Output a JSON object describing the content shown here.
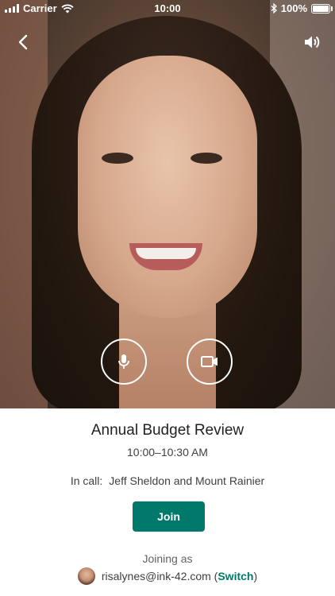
{
  "status_bar": {
    "carrier": "Carrier",
    "time": "10:00",
    "battery": "100%",
    "battery_level": 1.0
  },
  "icons": {
    "back": "chevron-left-icon",
    "sound": "speaker-icon",
    "microphone": "microphone-icon",
    "camera": "video-camera-icon",
    "bluetooth": "bluetooth-icon",
    "wifi": "wifi-icon"
  },
  "meeting": {
    "title": "Annual Budget Review",
    "time_range": "10:00–10:30 AM",
    "in_call_label": "In call:",
    "in_call_names": "Jeff Sheldon and Mount Rainier"
  },
  "join_button": {
    "label": "Join"
  },
  "account": {
    "joining_as": "Joining as",
    "email": "risalynes@ink-42.com",
    "open_paren": "(",
    "switch_label": "Switch",
    "close_paren": ")"
  },
  "colors": {
    "accent": "#00796b",
    "text_primary": "#202124",
    "text_secondary": "#5f6368"
  }
}
